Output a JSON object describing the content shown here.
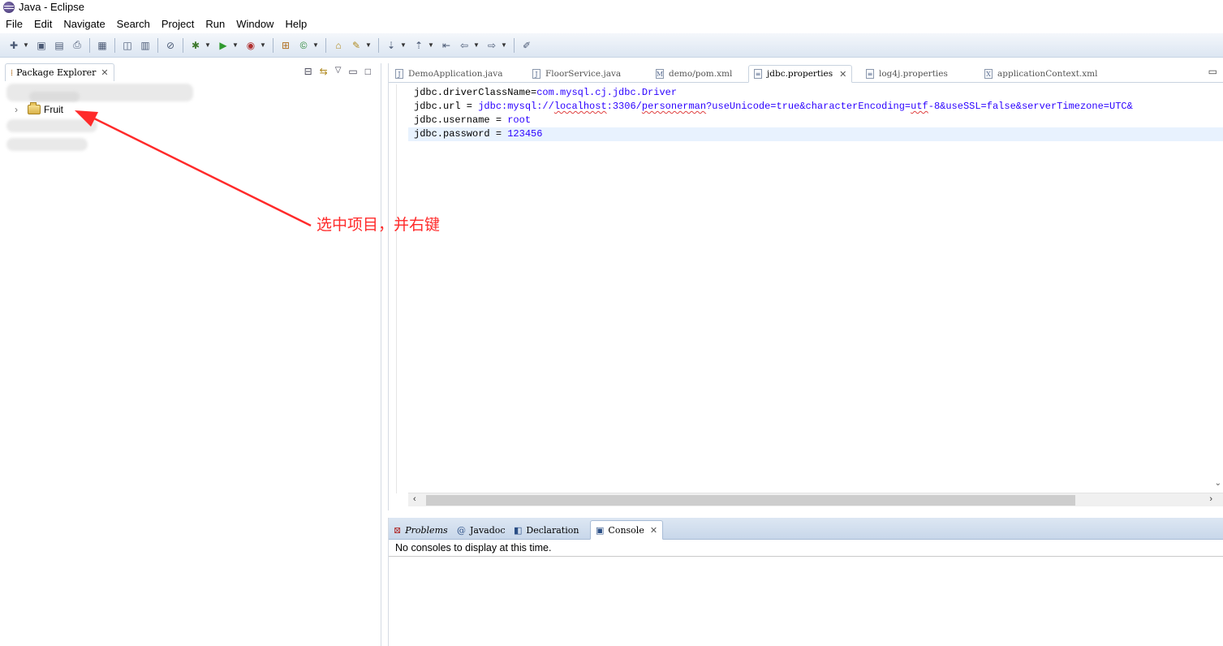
{
  "window": {
    "title": "Java - Eclipse"
  },
  "menu": [
    "File",
    "Edit",
    "Navigate",
    "Search",
    "Project",
    "Run",
    "Window",
    "Help"
  ],
  "package_explorer": {
    "tab_label": "Package Explorer",
    "project_name": "Fruit"
  },
  "editor": {
    "tabs": [
      {
        "label": "DemoApplication.java",
        "active": false
      },
      {
        "label": "FloorService.java",
        "active": false
      },
      {
        "label": "demo/pom.xml",
        "active": false
      },
      {
        "label": "jdbc.properties",
        "active": true
      },
      {
        "label": "log4j.properties",
        "active": false
      },
      {
        "label": "applicationContext.xml",
        "active": false
      }
    ],
    "lines": [
      {
        "key": "jdbc.driverClassName=",
        "value": "com.mysql.cj.jdbc.Driver"
      },
      {
        "key": "jdbc.url = ",
        "value_plain_1": "jdbc:mysql://",
        "value_squig_1": "localhost",
        "value_plain_2": ":3306/",
        "value_squig_2": "personerman",
        "value_plain_3": "?useUnicode=true&characterEncoding=",
        "value_squig_3": "utf",
        "value_plain_4": "-8&useSSL=false&serverTimezone=UTC&"
      },
      {
        "key": "jdbc.username = ",
        "value": "root"
      },
      {
        "key": "jdbc.password = ",
        "value": "123456"
      }
    ]
  },
  "console": {
    "tabs": [
      "Problems",
      "Javadoc",
      "Declaration",
      "Console"
    ],
    "message": "No consoles to display at this time."
  },
  "annotation": {
    "text": "选中项目，并右键",
    "color": "#ff2a2a"
  }
}
